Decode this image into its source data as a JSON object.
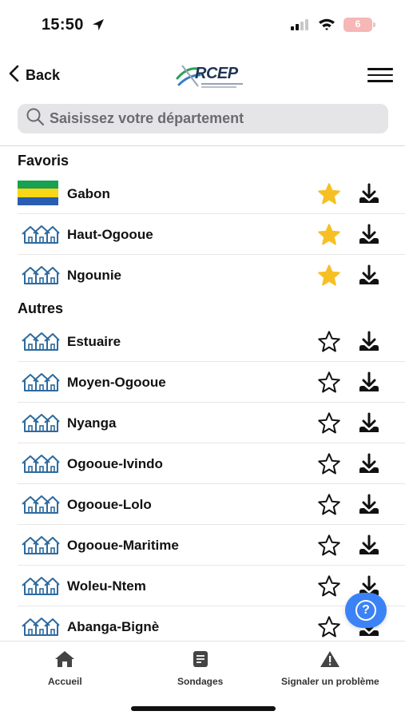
{
  "status_bar": {
    "time": "15:50",
    "battery": "6"
  },
  "nav": {
    "back_label": "Back",
    "logo_text": "RCEP",
    "menu_icon": "hamburger-menu-icon"
  },
  "search": {
    "placeholder": "Saisissez votre département",
    "value": ""
  },
  "sections": {
    "favorites_title": "Favoris",
    "others_title": "Autres"
  },
  "favorites": [
    {
      "label": "Gabon",
      "icon": "flag",
      "starred": true
    },
    {
      "label": "Haut-Ogooue",
      "icon": "houses-icon",
      "starred": true
    },
    {
      "label": "Ngounie",
      "icon": "houses-icon",
      "starred": true
    }
  ],
  "others": [
    {
      "label": "Estuaire",
      "icon": "houses-icon",
      "starred": false
    },
    {
      "label": "Moyen-Ogooue",
      "icon": "houses-icon",
      "starred": false
    },
    {
      "label": "Nyanga",
      "icon": "houses-icon",
      "starred": false
    },
    {
      "label": "Ogooue-Ivindo",
      "icon": "houses-icon",
      "starred": false
    },
    {
      "label": "Ogooue-Lolo",
      "icon": "houses-icon",
      "starred": false
    },
    {
      "label": "Ogooue-Maritime",
      "icon": "houses-icon",
      "starred": false
    },
    {
      "label": "Woleu-Ntem",
      "icon": "houses-icon",
      "starred": false
    },
    {
      "label": "Abanga-Bignè",
      "icon": "houses-icon",
      "starred": false
    }
  ],
  "help": {
    "label": "?"
  },
  "tabs": [
    {
      "label": "Accueil",
      "icon": "home-icon"
    },
    {
      "label": "Sondages",
      "icon": "document-icon"
    },
    {
      "label": "Signaler un problème",
      "icon": "warning-icon"
    }
  ],
  "colors": {
    "star_filled": "#f6c024",
    "accent_blue": "#3b82f6",
    "house_icon": "#2d6a9f",
    "flag_green": "#17a150",
    "flag_yellow": "#f9d616",
    "flag_blue": "#2a5db0"
  }
}
